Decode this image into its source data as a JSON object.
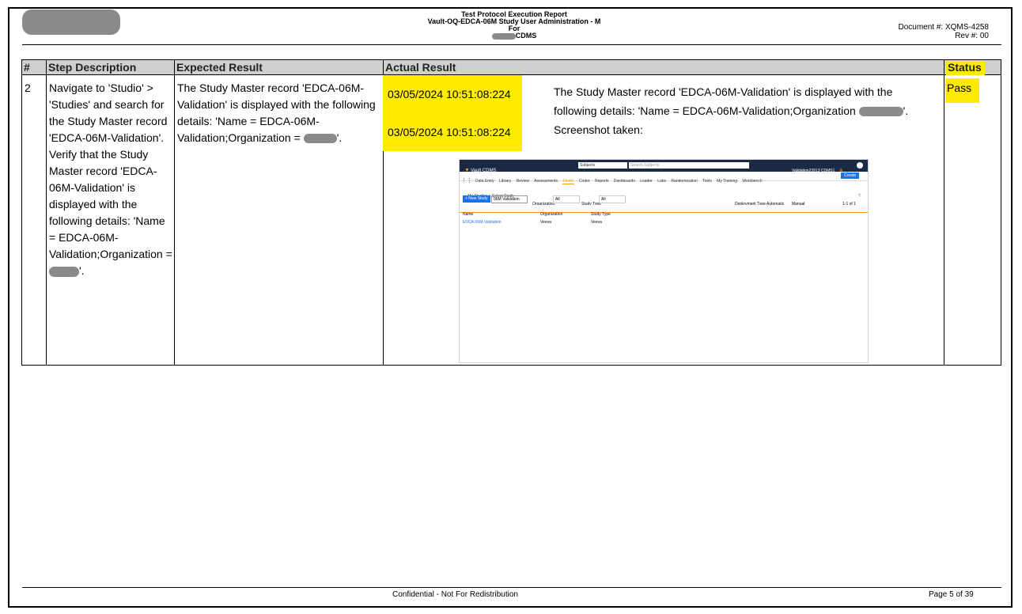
{
  "header": {
    "title_line1": "Test Protocol Execution Report",
    "title_line2": "Vault-OQ-EDCA-06M Study User Administration - M",
    "title_line3": "For",
    "title_line4": "CDMS",
    "document_number": "Document #: XQMS-4258",
    "revision": "Rev #: 00"
  },
  "table": {
    "columns": [
      "#",
      "Step Description",
      "Expected Result",
      "Actual Result",
      "Status"
    ],
    "row": {
      "number": "2",
      "step_description": "Navigate to 'Studio' > 'Studies' and search for the Study Master record 'EDCA-06M-Validation'. Verify that the Study Master record 'EDCA-06M-Validation' is displayed with the following details: 'Name = EDCA-06M-Validation;Organization = ",
      "step_description_end": "'.",
      "expected_result": "The Study Master record 'EDCA-06M-Validation' is displayed with the following details: 'Name = EDCA-06M-Validation;Organization = ",
      "expected_result_end": "'.",
      "actual_timestamp_1": "03/05/2024 10:51:08:224",
      "actual_timestamp_2": "03/05/2024 10:51:08:224",
      "actual_text_1": "The Study Master record 'EDCA-06M-Validation' is displayed with the following details: 'Name = EDCA-06M-Validation;Organization ",
      "actual_text_1_end": "'.",
      "actual_text_2": "Screenshot taken:",
      "status": "Pass"
    }
  },
  "screenshot": {
    "app_name": "Vault CDMS",
    "search_scope": "Subjects",
    "search_placeholder": "Search Subjects",
    "user": "Validation23913 CDMS1",
    "nav_items": [
      "Data Entry",
      "Library",
      "Review",
      "Assessments",
      "Studio",
      "Coder",
      "Reports",
      "Dashboards",
      "Loader",
      "Labs",
      "Randomization",
      "Tools",
      "My Training",
      "Workbench"
    ],
    "create_button": "Create",
    "breadcrumb_1": "My Studies",
    "breadcrumb_2": "Select Study",
    "new_study_button": "+ New Study",
    "filter_value": "06M Validation",
    "org_label": "Organization",
    "org_value": "All",
    "type_label": "Study Type",
    "type_value": "All",
    "deploy_label": "Deployment Type",
    "deploy_auto": "Automatic",
    "deploy_manual": "Manual",
    "paging": "1-1 of 1",
    "col_name": "Name",
    "col_org": "Organization",
    "col_type": "Study Type",
    "row_name": "EDCA-06M-Validation",
    "row_org": "Veeva",
    "row_type": "Veeva"
  },
  "footer": {
    "confidential": "Confidential - Not For Redistribution",
    "page": "Page 5 of 39"
  },
  "colors": {
    "highlight": "#ffeb00",
    "header_bg": "#cfcfcf",
    "app_nav": "#1a2a44",
    "accent": "#f39c12"
  }
}
